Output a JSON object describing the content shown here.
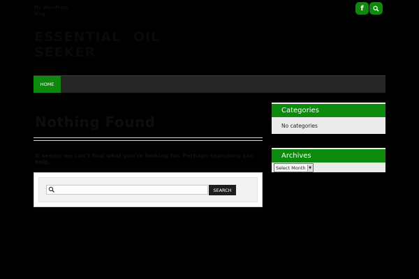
{
  "header": {
    "tagline": "My WordPress Blog",
    "site_title": "ESSENTIAL OIL SEEKER"
  },
  "social": {
    "facebook_glyph": "f",
    "icons": [
      "facebook-icon",
      "search-icon"
    ],
    "accent_color": "#0b8a0b"
  },
  "nav": {
    "items": [
      {
        "label": "HOME",
        "active": true
      }
    ]
  },
  "main": {
    "title": "Nothing Found",
    "notice": "It seems we can't find what you're looking for. Perhaps searching can help.",
    "search": {
      "placeholder": "",
      "value": "",
      "button_label": "SEARCH"
    }
  },
  "sidebar": {
    "categories": {
      "title": "Categories",
      "empty_text": "No categories"
    },
    "archives": {
      "title": "Archives",
      "select_value": "Select Month"
    }
  }
}
